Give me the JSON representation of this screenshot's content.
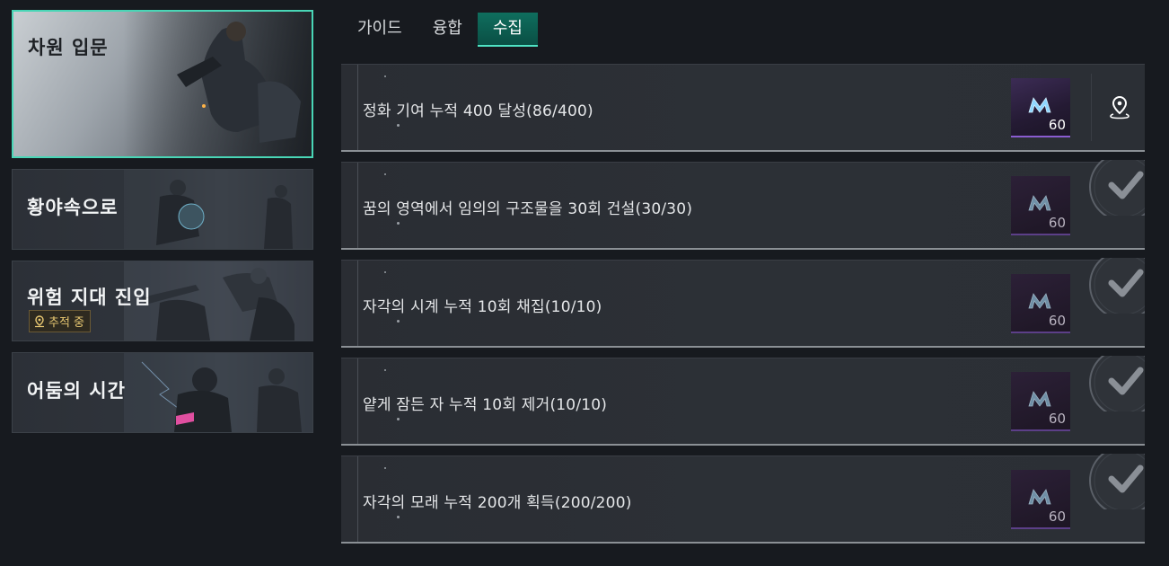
{
  "chapters": [
    {
      "title": "차원 입문",
      "active": true
    },
    {
      "title": "황야속으로",
      "active": false
    },
    {
      "title": "위험 지대 진입",
      "active": false,
      "badge": "추적 중"
    },
    {
      "title": "어둠의 시간",
      "active": false
    }
  ],
  "tabs": [
    {
      "label": "가이드",
      "active": false
    },
    {
      "label": "융합",
      "active": false
    },
    {
      "label": "수집",
      "active": true
    }
  ],
  "quests": [
    {
      "text": "정화 기여 누적 400 달성(86/400)",
      "reward_count": "60",
      "completed": false
    },
    {
      "text": "꿈의 영역에서 임의의 구조물을 30회 건설(30/30)",
      "reward_count": "60",
      "completed": true
    },
    {
      "text": "자각의 시계 누적 10회 채집(10/10)",
      "reward_count": "60",
      "completed": true
    },
    {
      "text": "얕게 잠든 자 누적 10회 제거(10/10)",
      "reward_count": "60",
      "completed": true
    },
    {
      "text": "자각의 모래 누적 200개 획득(200/200)",
      "reward_count": "60",
      "completed": true
    }
  ],
  "icons": {
    "track": "location-pin-icon",
    "reward": "reward-currency-icon",
    "locate": "map-pin-icon",
    "complete": "checkmark-icon"
  },
  "colors": {
    "accent": "#49d6b6",
    "tab_active": "#0a5c4f",
    "reward_border": "#8a5cd0",
    "tracking": "#e8c872"
  }
}
